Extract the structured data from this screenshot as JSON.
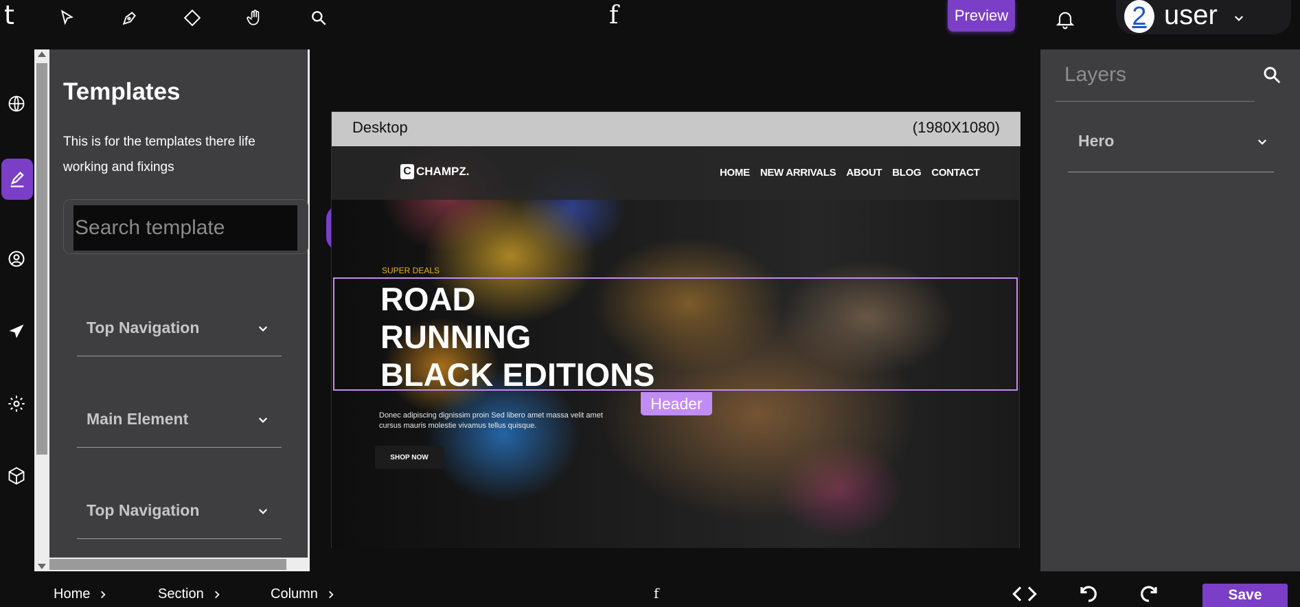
{
  "topbar": {
    "logo": "t",
    "center_glyph": "f",
    "preview_label": "Preview",
    "user": {
      "avatar_text": "2",
      "name": "user"
    },
    "tools": [
      "pointer-icon",
      "pen-icon",
      "diamond-icon",
      "hand-icon",
      "search-icon"
    ]
  },
  "rail": {
    "items": [
      "globe-icon",
      "edit-icon",
      "user-circle-icon",
      "send-icon",
      "gear-icon",
      "cube-icon"
    ],
    "active": "edit-icon"
  },
  "templates": {
    "title": "Templates",
    "description": "This is for the templates there life working and fixings",
    "search_placeholder": "Search template",
    "sections": [
      {
        "label": "Top Navigation"
      },
      {
        "label": "Main Element"
      },
      {
        "label": "Top Navigation"
      }
    ]
  },
  "canvas": {
    "device": "Desktop",
    "resolution": "(1980X1080)",
    "site": {
      "brand_mark": "C",
      "brand": "CHAMPZ.",
      "nav": [
        "HOME",
        "NEW ARRIVALS",
        "ABOUT",
        "BLOG",
        "CONTACT"
      ],
      "eyebrow": "SUPER DEALS",
      "headline": [
        "ROAD",
        "RUNNING",
        "BLACK EDITIONS"
      ],
      "body": "Donec adipiscing dignissim proin Sed libero amet massa velit amet cursus mauris molestie vivamus tellus quisque.",
      "cta": "SHOP NOW"
    },
    "selection_label": "Header"
  },
  "layers": {
    "title": "Layers",
    "items": [
      {
        "label": "Hero"
      }
    ]
  },
  "bottombar": {
    "breadcrumbs": [
      "Home",
      "Section",
      "Column"
    ],
    "center_glyph": "f",
    "save_label": "Save"
  },
  "colors": {
    "accent": "#7b3fc7",
    "selection": "#c18cf3",
    "panel": "#3e3e40",
    "background": "#0f0f10",
    "eyebrow": "#e8b320"
  }
}
